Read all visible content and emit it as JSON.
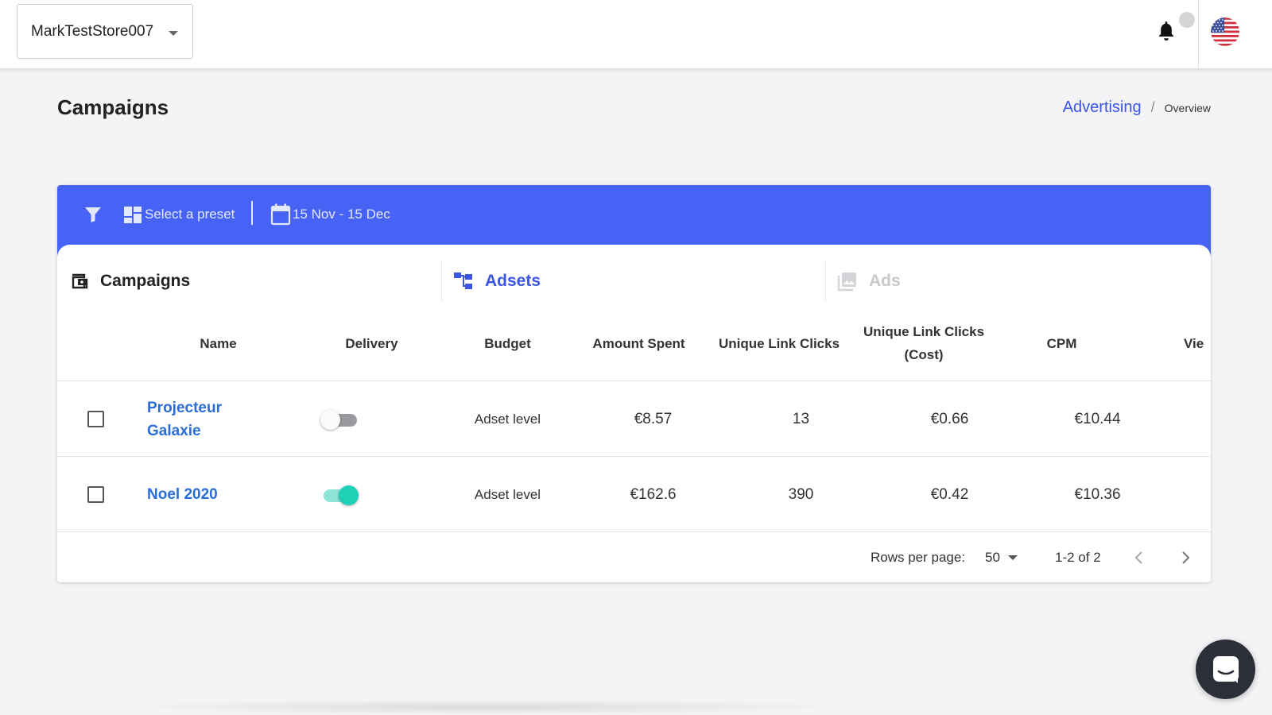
{
  "header": {
    "store_name": "MarkTestStore007"
  },
  "page": {
    "title": "Campaigns",
    "breadcrumb": {
      "link": "Advertising",
      "separator": "/",
      "current": "Overview"
    }
  },
  "toolbar": {
    "preset_label": "Select a preset",
    "date_range": "15 Nov - 15 Dec",
    "bg_color": "#4663f5"
  },
  "tabs": [
    {
      "label": "Campaigns",
      "state": "active"
    },
    {
      "label": "Adsets",
      "state": "link"
    },
    {
      "label": "Ads",
      "state": "disabled"
    }
  ],
  "table": {
    "columns": [
      "Name",
      "Delivery",
      "Budget",
      "Amount Spent",
      "Unique Link Clicks",
      "Unique Link Clicks (Cost)",
      "CPM",
      "Vie"
    ],
    "rows": [
      {
        "name": "Projecteur Galaxie",
        "delivery_on": false,
        "budget": "Adset level",
        "amount_spent": "€8.57",
        "unique_link_clicks": "13",
        "unique_link_clicks_cost": "€0.66",
        "cpm": "€10.44"
      },
      {
        "name": "Noel 2020",
        "delivery_on": true,
        "budget": "Adset level",
        "amount_spent": "€162.6",
        "unique_link_clicks": "390",
        "unique_link_clicks_cost": "€0.42",
        "cpm": "€10.36"
      }
    ]
  },
  "pagination": {
    "rows_per_page_label": "Rows per page:",
    "rows_per_page": "50",
    "range": "1-2 of 2"
  },
  "icons": {
    "store_dropdown": "chevron-down-icon",
    "notifications": "bell-icon",
    "language": "us-flag-icon",
    "filter": "filter-icon",
    "preset": "dashboard-grid-icon",
    "date": "calendar-icon",
    "tab_campaigns": "wallet-icon",
    "tab_adsets": "hierarchy-icon",
    "tab_ads": "image-icon",
    "chat": "chat-icon"
  },
  "colors": {
    "accent": "#3b55e6",
    "link": "#2a6dd8",
    "toggle_on": "#1fcfb6"
  }
}
